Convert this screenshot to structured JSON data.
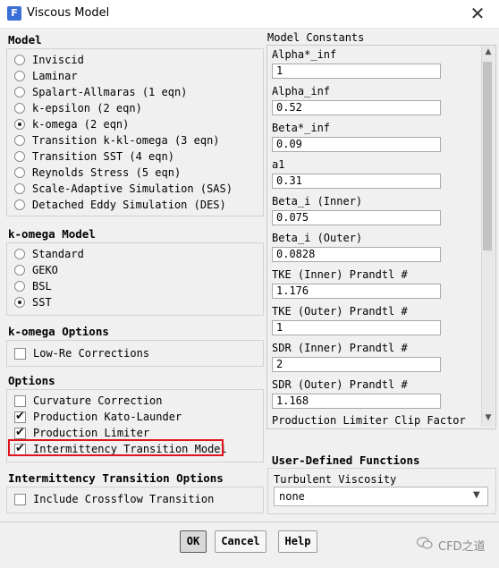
{
  "window": {
    "title": "Viscous Model",
    "app_icon": "F",
    "close_label": "✕"
  },
  "model": {
    "heading": "Model",
    "options": [
      {
        "label": "Inviscid",
        "selected": false
      },
      {
        "label": "Laminar",
        "selected": false
      },
      {
        "label": "Spalart-Allmaras (1 eqn)",
        "selected": false
      },
      {
        "label": "k-epsilon (2 eqn)",
        "selected": false
      },
      {
        "label": "k-omega (2 eqn)",
        "selected": true
      },
      {
        "label": "Transition k-kl-omega (3 eqn)",
        "selected": false
      },
      {
        "label": "Transition SST (4 eqn)",
        "selected": false
      },
      {
        "label": "Reynolds Stress (5 eqn)",
        "selected": false
      },
      {
        "label": "Scale-Adaptive Simulation (SAS)",
        "selected": false
      },
      {
        "label": "Detached Eddy Simulation (DES)",
        "selected": false
      }
    ]
  },
  "komega_model": {
    "heading": "k-omega Model",
    "options": [
      {
        "label": "Standard",
        "selected": false
      },
      {
        "label": "GEKO",
        "selected": false
      },
      {
        "label": "BSL",
        "selected": false
      },
      {
        "label": "SST",
        "selected": true
      }
    ]
  },
  "komega_options": {
    "heading": "k-omega Options",
    "low_re": {
      "label": "Low-Re Corrections",
      "checked": false
    }
  },
  "options": {
    "heading": "Options",
    "items": [
      {
        "label": "Curvature Correction",
        "checked": false
      },
      {
        "label": "Production Kato-Launder",
        "checked": true
      },
      {
        "label": "Production Limiter",
        "checked": true
      },
      {
        "label": "Intermittency Transition Model",
        "checked": true
      }
    ]
  },
  "intermittency": {
    "heading": "Intermittency Transition Options",
    "crossflow": {
      "label": "Include Crossflow Transition",
      "checked": false
    }
  },
  "constants": {
    "heading": "Model Constants",
    "items": [
      {
        "label": "Alpha*_inf",
        "value": "1"
      },
      {
        "label": "Alpha_inf",
        "value": "0.52"
      },
      {
        "label": "Beta*_inf",
        "value": "0.09"
      },
      {
        "label": "a1",
        "value": "0.31"
      },
      {
        "label": "Beta_i (Inner)",
        "value": "0.075"
      },
      {
        "label": "Beta_i (Outer)",
        "value": "0.0828"
      },
      {
        "label": "TKE (Inner) Prandtl #",
        "value": "1.176"
      },
      {
        "label": "TKE (Outer) Prandtl #",
        "value": "1"
      },
      {
        "label": "SDR (Inner) Prandtl #",
        "value": "2"
      },
      {
        "label": "SDR (Outer) Prandtl #",
        "value": "1.168"
      }
    ],
    "last_label": "Production Limiter Clip Factor"
  },
  "udf": {
    "heading": "User-Defined Functions",
    "turb_visc_label": "Turbulent Viscosity",
    "turb_visc_value": "none"
  },
  "buttons": {
    "ok": "OK",
    "cancel": "Cancel",
    "help": "Help"
  },
  "watermark": "CFD之道",
  "colors": {
    "highlight_border": "#e0141e",
    "accent": "#3a6fd8"
  }
}
